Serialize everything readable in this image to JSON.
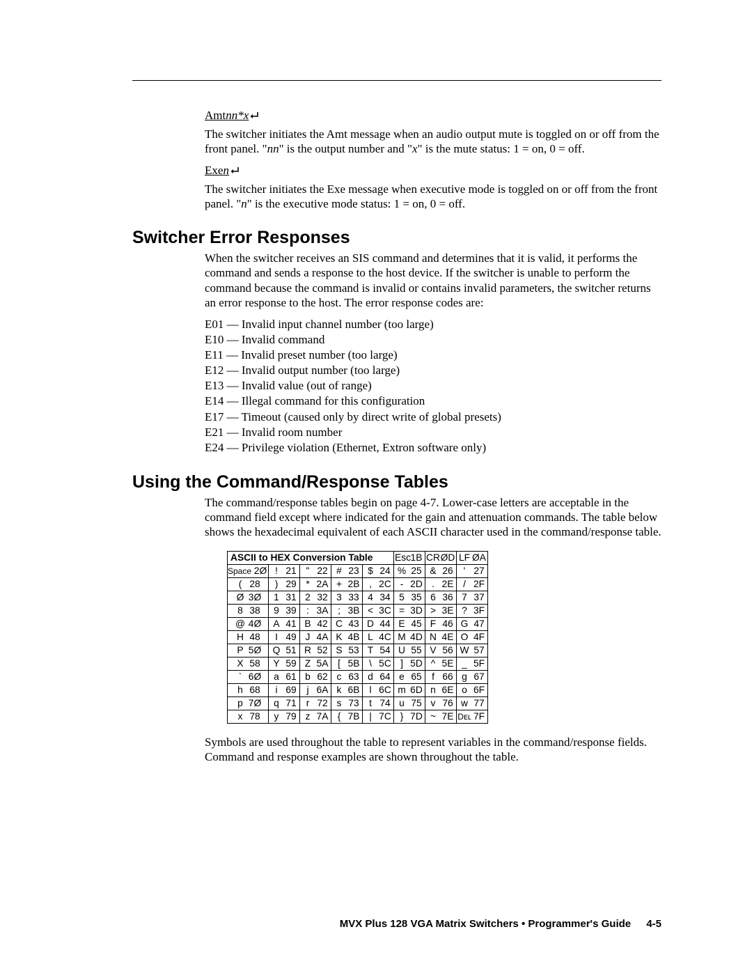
{
  "messages": [
    {
      "head_pre": "Amt",
      "head_it": "nn*x",
      "body": "The switcher initiates the Amt message when an audio output mute is toggled on or off from the front panel.  \"<i>nn</i>\" is the output number and \"<i>x</i>\" is the mute status: 1 = on, 0 = off."
    },
    {
      "head_pre": "Exe",
      "head_it": "n",
      "body": "The switcher initiates the Exe message when executive mode is toggled on or off from the front panel.  \"<i>n</i>\" is the executive mode status: 1 = on, 0 = off."
    }
  ],
  "section1": {
    "title": "Switcher Error Responses",
    "intro": "When the switcher receives an SIS command and determines that it is valid, it performs the command and sends a response to the host device.  If the switcher is unable to perform the command because the command is invalid or contains invalid parameters, the switcher returns an error response to the host.  The error response codes are:",
    "errors": [
      "E01 — Invalid input channel number (too large)",
      "E10 — Invalid command",
      "E11 — Invalid preset number (too large)",
      "E12 — Invalid output number (too large)",
      "E13 — Invalid value (out of range)",
      "E14 — Illegal command for this configuration",
      "E17 — Timeout (caused only by direct write of global presets)",
      "E21 — Invalid room number",
      "E24 — Privilege violation (Ethernet, Extron software only)"
    ]
  },
  "section2": {
    "title": "Using the Command/Response Tables",
    "intro": "The command/response tables begin on page 4-7.  Lower-case letters are acceptable in the command field except where indicated for the gain and attenuation commands.  The table below shows the hexadecimal equivalent of each ASCII character used in the command/response table.",
    "ascii_title": "ASCII to HEX  Conversion Table",
    "header_pairs": [
      [
        "Esc",
        "1B"
      ],
      [
        "CR",
        "ØD"
      ],
      [
        "LF",
        "ØA"
      ]
    ],
    "rows": [
      [
        [
          "Space",
          "2Ø"
        ],
        [
          "!",
          "21"
        ],
        [
          "\"",
          "22"
        ],
        [
          "#",
          "23"
        ],
        [
          "$",
          "24"
        ],
        [
          "%",
          "25"
        ],
        [
          "&",
          "26"
        ],
        [
          "'",
          "27"
        ]
      ],
      [
        [
          "(",
          "28"
        ],
        [
          ")",
          "29"
        ],
        [
          "*",
          "2A"
        ],
        [
          "+",
          "2B"
        ],
        [
          ",",
          "2C"
        ],
        [
          "-",
          "2D"
        ],
        [
          ".",
          "2E"
        ],
        [
          "/",
          "2F"
        ]
      ],
      [
        [
          "Ø",
          "3Ø"
        ],
        [
          "1",
          "31"
        ],
        [
          "2",
          "32"
        ],
        [
          "3",
          "33"
        ],
        [
          "4",
          "34"
        ],
        [
          "5",
          "35"
        ],
        [
          "6",
          "36"
        ],
        [
          "7",
          "37"
        ]
      ],
      [
        [
          "8",
          "38"
        ],
        [
          "9",
          "39"
        ],
        [
          ":",
          "3A"
        ],
        [
          ";",
          "3B"
        ],
        [
          "<",
          "3C"
        ],
        [
          "=",
          "3D"
        ],
        [
          ">",
          "3E"
        ],
        [
          "?",
          "3F"
        ]
      ],
      [
        [
          "@",
          "4Ø"
        ],
        [
          "A",
          "41"
        ],
        [
          "B",
          "42"
        ],
        [
          "C",
          "43"
        ],
        [
          "D",
          "44"
        ],
        [
          "E",
          "45"
        ],
        [
          "F",
          "46"
        ],
        [
          "G",
          "47"
        ]
      ],
      [
        [
          "H",
          "48"
        ],
        [
          "I",
          "49"
        ],
        [
          "J",
          "4A"
        ],
        [
          "K",
          "4B"
        ],
        [
          "L",
          "4C"
        ],
        [
          "M",
          "4D"
        ],
        [
          "N",
          "4E"
        ],
        [
          "O",
          "4F"
        ]
      ],
      [
        [
          "P",
          "5Ø"
        ],
        [
          "Q",
          "51"
        ],
        [
          "R",
          "52"
        ],
        [
          "S",
          "53"
        ],
        [
          "T",
          "54"
        ],
        [
          "U",
          "55"
        ],
        [
          "V",
          "56"
        ],
        [
          "W",
          "57"
        ]
      ],
      [
        [
          "X",
          "58"
        ],
        [
          "Y",
          "59"
        ],
        [
          "Z",
          "5A"
        ],
        [
          "[",
          "5B"
        ],
        [
          "\\",
          "5C"
        ],
        [
          "]",
          "5D"
        ],
        [
          "^",
          "5E"
        ],
        [
          "_",
          "5F"
        ]
      ],
      [
        [
          "`",
          "6Ø"
        ],
        [
          "a",
          "61"
        ],
        [
          "b",
          "62"
        ],
        [
          "c",
          "63"
        ],
        [
          "d",
          "64"
        ],
        [
          "e",
          "65"
        ],
        [
          "f",
          "66"
        ],
        [
          "g",
          "67"
        ]
      ],
      [
        [
          "h",
          "68"
        ],
        [
          "i",
          "69"
        ],
        [
          "j",
          "6A"
        ],
        [
          "k",
          "6B"
        ],
        [
          "l",
          "6C"
        ],
        [
          "m",
          "6D"
        ],
        [
          "n",
          "6E"
        ],
        [
          "o",
          "6F"
        ]
      ],
      [
        [
          "p",
          "7Ø"
        ],
        [
          "q",
          "71"
        ],
        [
          "r",
          "72"
        ],
        [
          "s",
          "73"
        ],
        [
          "t",
          "74"
        ],
        [
          "u",
          "75"
        ],
        [
          "v",
          "76"
        ],
        [
          "w",
          "77"
        ]
      ],
      [
        [
          "x",
          "78"
        ],
        [
          "y",
          "79"
        ],
        [
          "z",
          "7A"
        ],
        [
          "{",
          "7B"
        ],
        [
          "|",
          "7C"
        ],
        [
          "}",
          "7D"
        ],
        [
          "~",
          "7E"
        ],
        [
          "Dᴇʟ",
          "7F"
        ]
      ]
    ],
    "outro": "Symbols are used throughout the table to represent variables in the command/response fields.  Command and response examples are shown throughout the table."
  },
  "footer": {
    "text": "MVX Plus 128 VGA Matrix Switchers • Programmer's Guide",
    "page": "4-5"
  },
  "chart_data": {
    "type": "table",
    "title": "ASCII to HEX Conversion Table",
    "data": {
      " ": "20",
      "!": "21",
      "\"": "22",
      "#": "23",
      "$": "24",
      "%": "25",
      "&": "26",
      "'": "27",
      "(": "28",
      ")": "29",
      "*": "2A",
      "+": "2B",
      ",": "2C",
      "-": "2D",
      ".": "2E",
      "/": "2F",
      "0": "30",
      "1": "31",
      "2": "32",
      "3": "33",
      "4": "34",
      "5": "35",
      "6": "36",
      "7": "37",
      "8": "38",
      "9": "39",
      ":": "3A",
      ";": "3B",
      "<": "3C",
      "=": "3D",
      ">": "3E",
      "?": "3F",
      "@": "40",
      "A": "41",
      "B": "42",
      "C": "43",
      "D": "44",
      "E": "45",
      "F": "46",
      "G": "47",
      "H": "48",
      "I": "49",
      "J": "4A",
      "K": "4B",
      "L": "4C",
      "M": "4D",
      "N": "4E",
      "O": "4F",
      "P": "50",
      "Q": "51",
      "R": "52",
      "S": "53",
      "T": "54",
      "U": "55",
      "V": "56",
      "W": "57",
      "X": "58",
      "Y": "59",
      "Z": "5A",
      "[": "5B",
      "\\": "5C",
      "]": "5D",
      "^": "5E",
      "_": "5F",
      "`": "60",
      "a": "61",
      "b": "62",
      "c": "63",
      "d": "64",
      "e": "65",
      "f": "66",
      "g": "67",
      "h": "68",
      "i": "69",
      "j": "6A",
      "k": "6B",
      "l": "6C",
      "m": "6D",
      "n": "6E",
      "o": "6F",
      "p": "70",
      "q": "71",
      "r": "72",
      "s": "73",
      "t": "74",
      "u": "75",
      "v": "76",
      "w": "77",
      "x": "78",
      "y": "79",
      "z": "7A",
      "{": "7B",
      "|": "7C",
      "}": "7D",
      "~": "7E",
      "DEL": "7F",
      "Esc": "1B",
      "CR": "0D",
      "LF": "0A"
    }
  }
}
